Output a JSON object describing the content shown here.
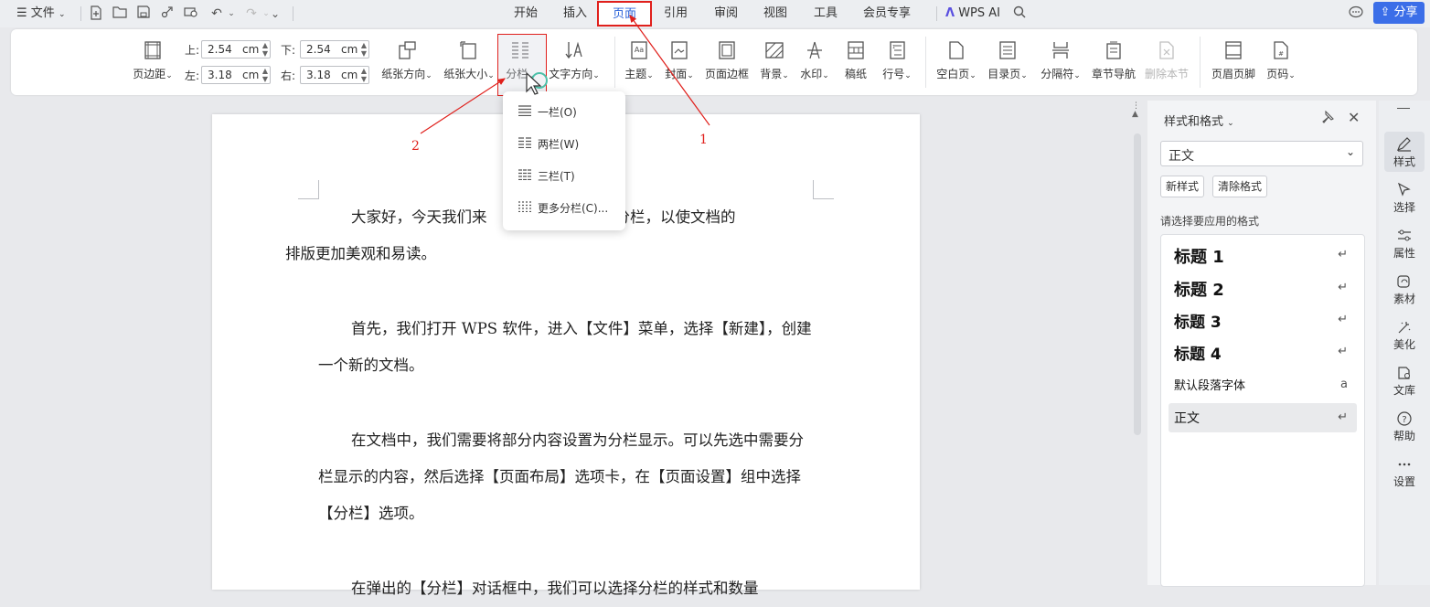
{
  "topbar": {
    "file_menu": "文件",
    "tabs": [
      "开始",
      "插入",
      "页面",
      "引用",
      "审阅",
      "视图",
      "工具",
      "会员专享"
    ],
    "active_tab": "页面",
    "wps_ai": "WPS AI",
    "share": "分享"
  },
  "ribbon": {
    "margins": {
      "top_label": "上:",
      "top_value": "2.54",
      "bottom_label": "下:",
      "bottom_value": "2.54",
      "left_label": "左:",
      "left_value": "3.18",
      "right_label": "右:",
      "right_value": "3.18",
      "unit": "cm"
    },
    "buttons": {
      "margin": "页边距",
      "orientation": "纸张方向",
      "size": "纸张大小",
      "columns": "分栏",
      "text_direction": "文字方向",
      "theme": "主题",
      "cover": "封面",
      "page_border": "页面边框",
      "background": "背景",
      "watermark": "水印",
      "manuscript": "稿纸",
      "line_number": "行号",
      "blank_page": "空白页",
      "toc_page": "目录页",
      "separator": "分隔符",
      "chapter_nav": "章节导航",
      "delete_section": "删除本节",
      "header_footer": "页眉页脚",
      "page_number": "页码"
    }
  },
  "dropdown": {
    "items": [
      "一栏(O)",
      "两栏(W)",
      "三栏(T)",
      "更多分栏(C)..."
    ]
  },
  "document": {
    "paragraphs": [
      "大家好，今天我们来介绍一下如何设置分栏，以使文档的排版更加美观和易读。",
      "首先，我们打开 WPS 软件，进入【文件】菜单，选择【新建】，创建一个新的文档。",
      "在文档中，我们需要将部分内容设置为分栏显示。可以先选中需要分栏显示的内容，然后选择【页面布局】选项卡，在【页面设置】组中选择【分栏】选项。",
      "在弹出的【分栏】对话框中，我们可以选择分栏的样式和数量"
    ],
    "para1_line1_left": "大家好，今天我们来",
    "para1_line1_right": "如何设置分栏，以使文档的",
    "para1_line2": "排版更加美观和易读。"
  },
  "annotations": {
    "one": "1",
    "two": "2"
  },
  "panel": {
    "title": "样式和格式",
    "current_style": "正文",
    "new_style": "新样式",
    "clear_format": "清除格式",
    "prompt": "请选择要应用的格式",
    "styles": [
      {
        "name": "标题 1",
        "mark": "↵"
      },
      {
        "name": "标题 2",
        "mark": "↵"
      },
      {
        "name": "标题 3",
        "mark": "↵"
      },
      {
        "name": "标题 4",
        "mark": "↵"
      },
      {
        "name": "默认段落字体",
        "mark": "a"
      },
      {
        "name": "正文",
        "mark": "↵"
      }
    ]
  },
  "sidebar": {
    "items": [
      "样式",
      "选择",
      "属性",
      "素材",
      "美化",
      "文库",
      "帮助",
      "设置"
    ]
  },
  "colors": {
    "accent": "#3b6ee8",
    "annotation_red": "#e0201c"
  }
}
